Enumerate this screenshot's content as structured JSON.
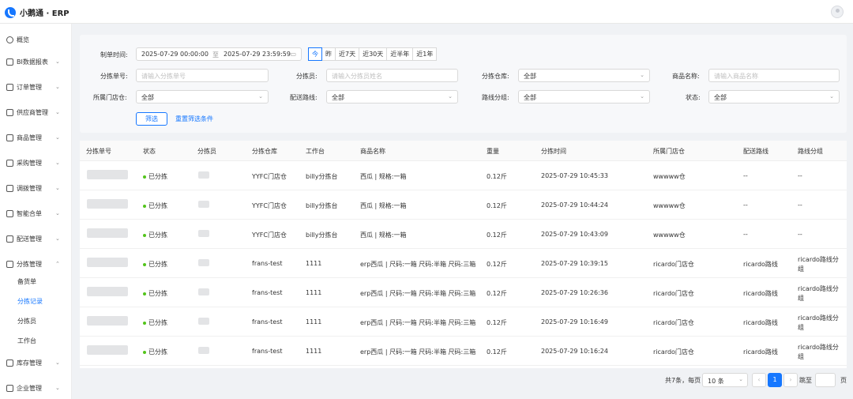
{
  "app": {
    "title": "小鹅通 · ERP"
  },
  "sidebar": {
    "items": [
      {
        "label": "概览",
        "icon": "dashboard-icon",
        "arrow": ""
      },
      {
        "label": "BI数据报表",
        "icon": "chart-icon",
        "arrow": "⌄"
      },
      {
        "label": "订单管理",
        "icon": "order-icon",
        "arrow": "⌄"
      },
      {
        "label": "供应商管理",
        "icon": "supplier-icon",
        "arrow": "⌄"
      },
      {
        "label": "商品管理",
        "icon": "product-icon",
        "arrow": "⌄"
      },
      {
        "label": "采购管理",
        "icon": "purchase-icon",
        "arrow": "⌄"
      },
      {
        "label": "调拨管理",
        "icon": "transfer-icon",
        "arrow": "⌄"
      },
      {
        "label": "智能合单",
        "icon": "merge-icon",
        "arrow": "⌄"
      },
      {
        "label": "配送管理",
        "icon": "delivery-icon",
        "arrow": "⌄"
      },
      {
        "label": "分拣管理",
        "icon": "sorting-icon",
        "arrow": "⌃"
      },
      {
        "label": "库存管理",
        "icon": "inventory-icon",
        "arrow": "⌄"
      },
      {
        "label": "企业管理",
        "icon": "enterprise-icon",
        "arrow": "⌄"
      }
    ],
    "sub_items": [
      {
        "label": "备货单"
      },
      {
        "label": "分拣记录"
      },
      {
        "label": "分拣员"
      },
      {
        "label": "工作台"
      }
    ]
  },
  "filters": {
    "create_time_label": "制单时间:",
    "start_time": "2025-07-29 00:00:00",
    "range_sep": "至",
    "end_time": "2025-07-29 23:59:59",
    "quick_ranges": [
      "今",
      "昨",
      "近7天",
      "近30天",
      "近半年",
      "近1年"
    ],
    "sort_no_label": "分拣单号:",
    "sort_no_placeholder": "请输入分拣单号",
    "sorter_label": "分拣员:",
    "sorter_placeholder": "请输入分拣员姓名",
    "warehouse_label": "分拣仓库:",
    "warehouse_value": "全部",
    "product_label": "商品名称:",
    "product_placeholder": "请输入商品名称",
    "store_label": "所属门店仓:",
    "store_value": "全部",
    "route_label": "配送路线:",
    "route_value": "全部",
    "route_group_label": "路线分组:",
    "route_group_value": "全部",
    "status_label": "状态:",
    "status_value": "全部",
    "filter_button": "筛选",
    "reset_link": "重置筛选条件"
  },
  "table": {
    "columns": [
      "分拣单号",
      "状态",
      "分拣员",
      "分拣仓库",
      "工作台",
      "商品名称",
      "重量",
      "分拣时间",
      "所属门店仓",
      "配送路线",
      "路线分组"
    ],
    "rows": [
      {
        "status": "已分拣",
        "warehouse": "YYFC门店仓",
        "workbench": "billy分拣台",
        "product": "西瓜 | 规格:一箱",
        "weight": "0.12斤",
        "time": "2025-07-29 10:45:33",
        "store": "wwwww仓",
        "route": "--",
        "group": "--"
      },
      {
        "status": "已分拣",
        "warehouse": "YYFC门店仓",
        "workbench": "billy分拣台",
        "product": "西瓜 | 规格:一箱",
        "weight": "0.12斤",
        "time": "2025-07-29 10:44:24",
        "store": "wwwww仓",
        "route": "--",
        "group": "--"
      },
      {
        "status": "已分拣",
        "warehouse": "YYFC门店仓",
        "workbench": "billy分拣台",
        "product": "西瓜 | 规格:一箱",
        "weight": "0.12斤",
        "time": "2025-07-29 10:43:09",
        "store": "wwwww仓",
        "route": "--",
        "group": "--"
      },
      {
        "status": "已分拣",
        "warehouse": "frans-test",
        "workbench": "1111",
        "product": "erp西瓜 | 尺码:一箱 尺码:半箱 尺码:三箱",
        "weight": "0.12斤",
        "time": "2025-07-29 10:39:15",
        "store": "ricardo门店仓",
        "route": "ricardo路线",
        "group": "ricardo路线分组"
      },
      {
        "status": "已分拣",
        "warehouse": "frans-test",
        "workbench": "1111",
        "product": "erp西瓜 | 尺码:一箱 尺码:半箱 尺码:三箱",
        "weight": "0.12斤",
        "time": "2025-07-29 10:26:36",
        "store": "ricardo门店仓",
        "route": "ricardo路线",
        "group": "ricardo路线分组"
      },
      {
        "status": "已分拣",
        "warehouse": "frans-test",
        "workbench": "1111",
        "product": "erp西瓜 | 尺码:一箱 尺码:半箱 尺码:三箱",
        "weight": "0.12斤",
        "time": "2025-07-29 10:16:49",
        "store": "ricardo门店仓",
        "route": "ricardo路线",
        "group": "ricardo路线分组"
      },
      {
        "status": "已分拣",
        "warehouse": "frans-test",
        "workbench": "1111",
        "product": "erp西瓜 | 尺码:一箱 尺码:半箱 尺码:三箱",
        "weight": "0.12斤",
        "time": "2025-07-29 10:16:24",
        "store": "ricardo门店仓",
        "route": "ricardo路线",
        "group": "ricardo路线分组"
      }
    ]
  },
  "pagination": {
    "summary": "共7条，每页",
    "page_size": "10 条",
    "current_page": "1",
    "jump_label": "跳至",
    "page_unit": "页"
  },
  "colors": {
    "accent": "#1677ff",
    "success": "#52c41a"
  }
}
